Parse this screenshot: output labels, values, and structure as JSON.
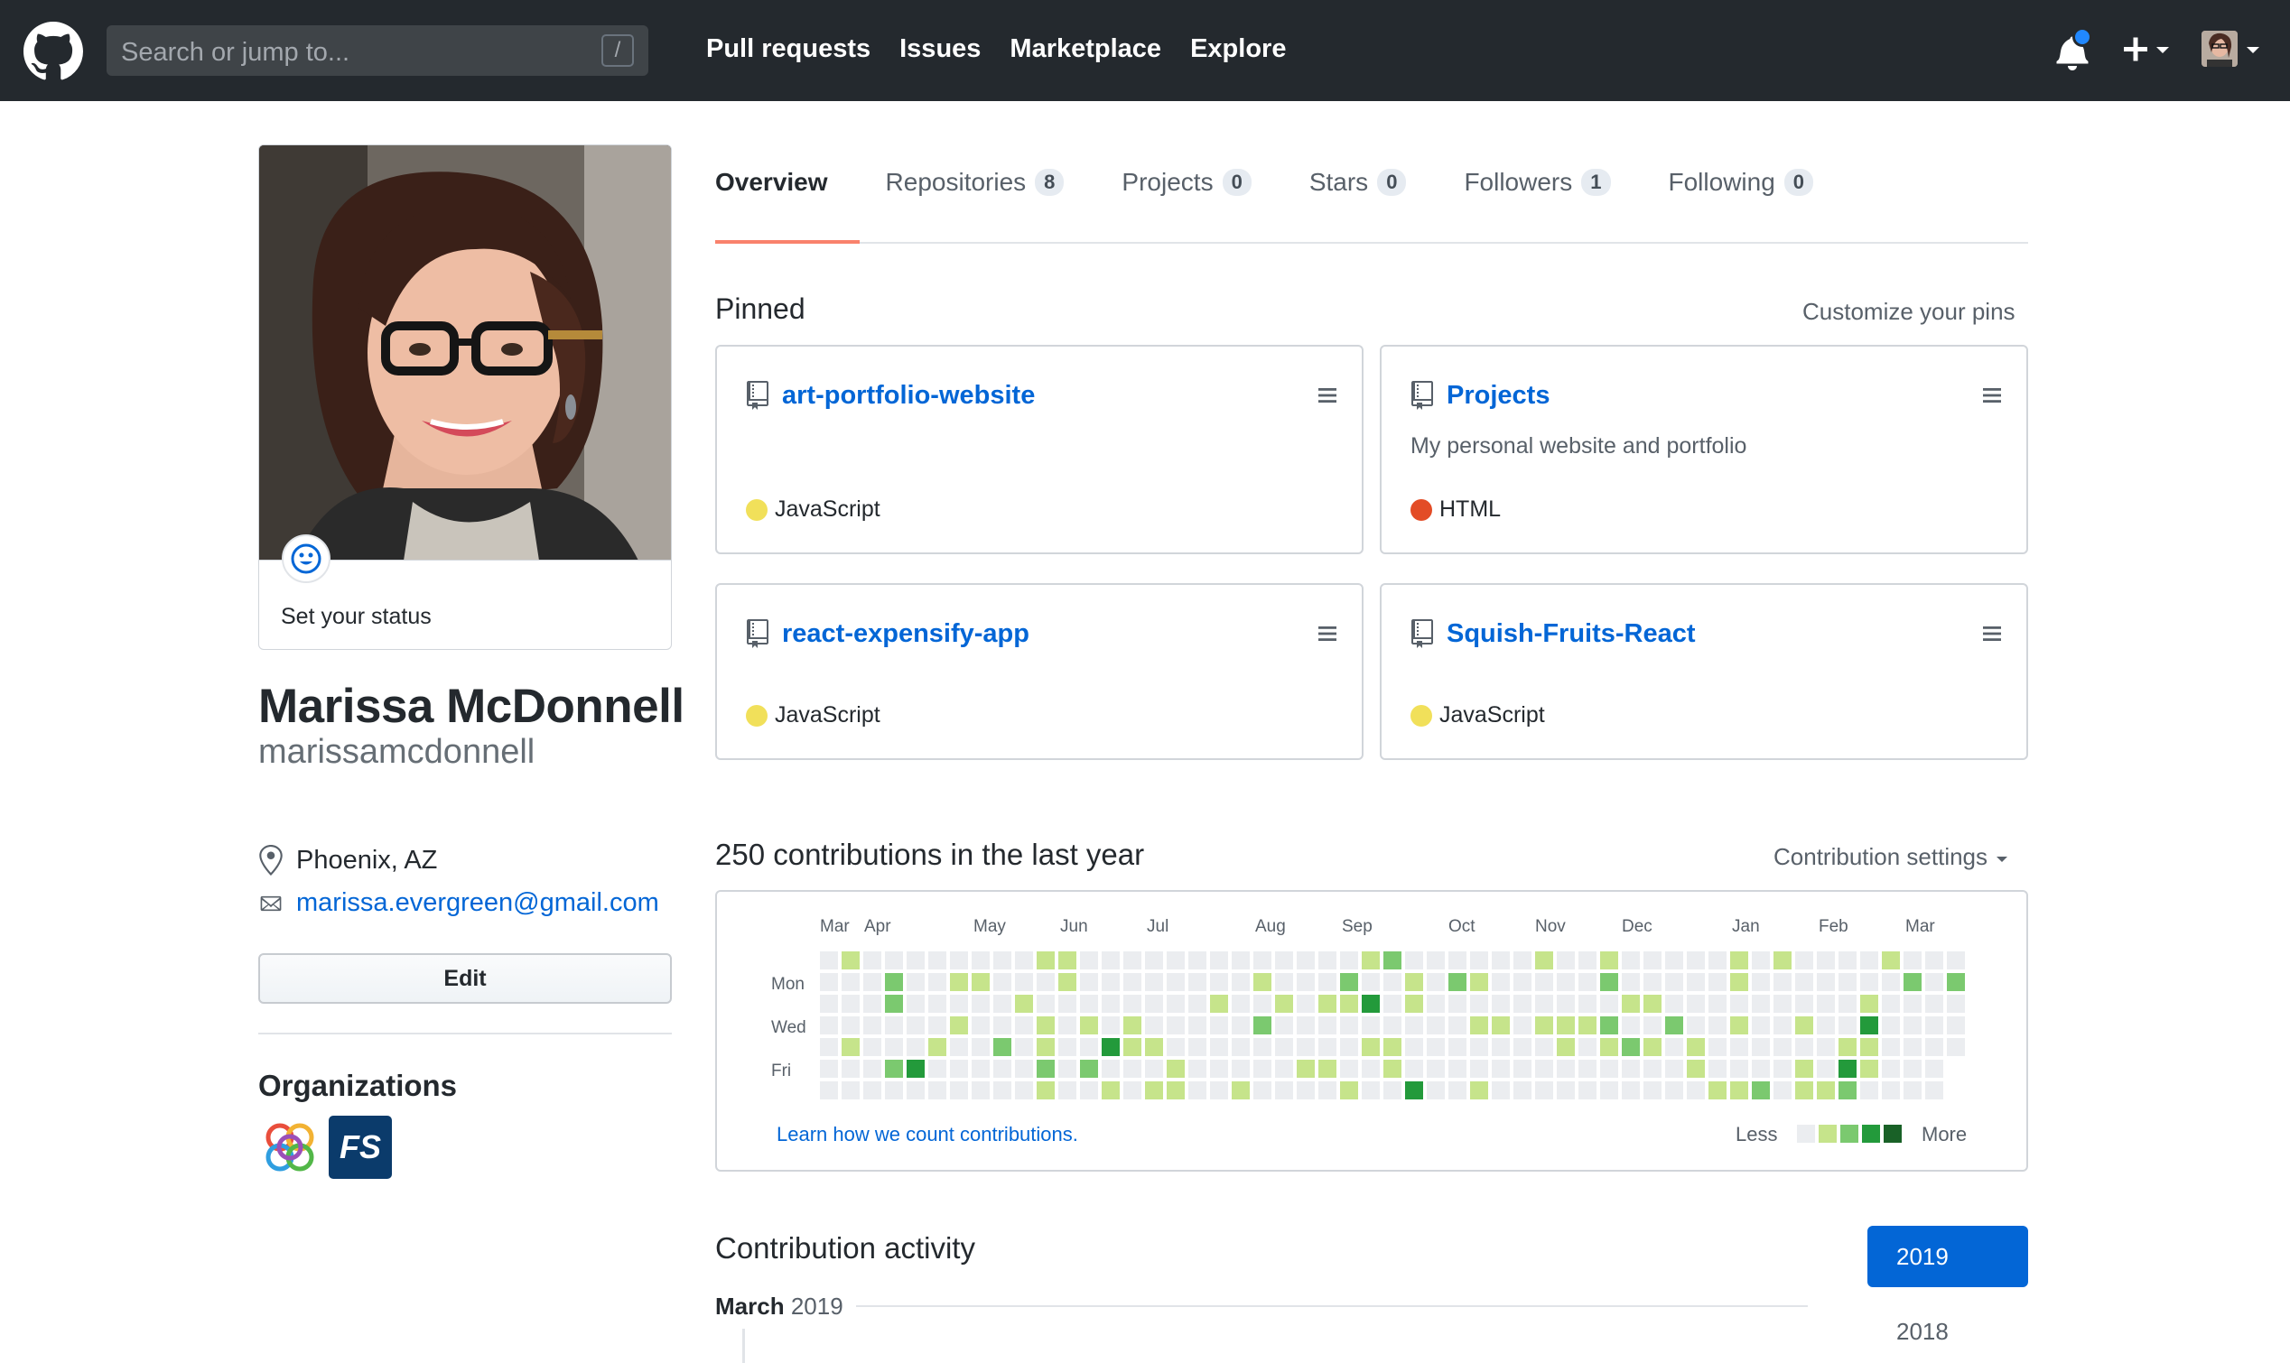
{
  "header": {
    "search_placeholder": "Search or jump to...",
    "search_shortcut": "/",
    "nav": [
      "Pull requests",
      "Issues",
      "Marketplace",
      "Explore"
    ],
    "logo_icon": "github-octocat-icon",
    "notification_icon": "bell-icon",
    "create_icon": "plus-icon",
    "accent_notification_color": "#2188ff"
  },
  "profile": {
    "status_text": "Set your status",
    "full_name": "Marissa McDonnell",
    "username": "marissamcdonnell",
    "location": "Phoenix, AZ",
    "email": "marissa.evergreen@gmail.com",
    "edit_label": "Edit",
    "organizations_title": "Organizations",
    "org2_text": "FS"
  },
  "tabs": [
    {
      "label": "Overview",
      "count": null
    },
    {
      "label": "Repositories",
      "count": "8"
    },
    {
      "label": "Projects",
      "count": "0"
    },
    {
      "label": "Stars",
      "count": "0"
    },
    {
      "label": "Followers",
      "count": "1"
    },
    {
      "label": "Following",
      "count": "0"
    }
  ],
  "pinned": {
    "title": "Pinned",
    "customize": "Customize your pins",
    "repos": [
      {
        "name": "art-portfolio-website",
        "description": "",
        "language": "JavaScript",
        "lang_color": "#f1e05a"
      },
      {
        "name": "Projects",
        "description": "My personal website and portfolio",
        "language": "HTML",
        "lang_color": "#e34c26"
      },
      {
        "name": "react-expensify-app",
        "description": "",
        "language": "JavaScript",
        "lang_color": "#f1e05a"
      },
      {
        "name": "Squish-Fruits-React",
        "description": "",
        "language": "JavaScript",
        "lang_color": "#f1e05a"
      }
    ]
  },
  "contributions": {
    "title": "250 contributions in the last year",
    "settings": "Contribution settings",
    "months": [
      "Mar",
      "Apr",
      "May",
      "Jun",
      "Jul",
      "Aug",
      "Sep",
      "Oct",
      "Nov",
      "Dec",
      "Jan",
      "Feb",
      "Mar"
    ],
    "days": [
      "Mon",
      "Wed",
      "Fri"
    ],
    "learn_link": "Learn how we count contributions.",
    "less": "Less",
    "more": "More",
    "level_colors": [
      "#ebedf0",
      "#c6e48b",
      "#7bc96f",
      "#239a3b",
      "#196127"
    ]
  },
  "activity": {
    "title": "Contribution activity",
    "month": "March",
    "year": "2019",
    "year_buttons": [
      "2019",
      "2018"
    ]
  }
}
